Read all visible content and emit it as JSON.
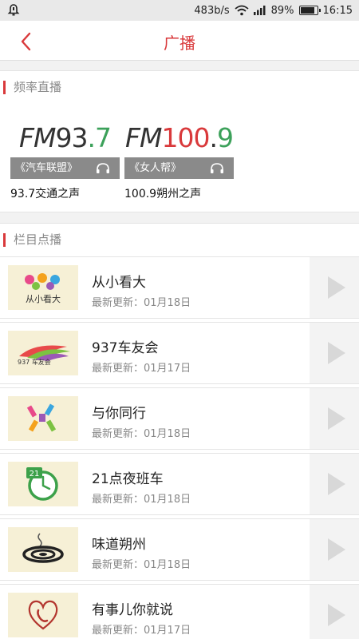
{
  "status_bar": {
    "speed": "483b/s",
    "battery": "89%",
    "time": "16:15"
  },
  "header": {
    "title": "广播"
  },
  "frequency": {
    "section_title": "频率直播",
    "stations": [
      {
        "logo_prefix": "FM",
        "logo_num1": "93",
        "logo_dot": ".",
        "logo_num2": "7",
        "program": "《汽车联盟》",
        "name": "93.7交通之声"
      },
      {
        "logo_prefix": "FM",
        "logo_num1": "100",
        "logo_dot": ".",
        "logo_num2": "9",
        "program": "《女人帮》",
        "name": "100.9朔州之声"
      }
    ]
  },
  "programs": {
    "section_title": "栏目点播",
    "items": [
      {
        "title": "从小看大",
        "updated": "最新更新：01月18日",
        "thumb_label": "从小看大"
      },
      {
        "title": "937车友会",
        "updated": "最新更新：01月17日",
        "thumb_label": "937 车友会"
      },
      {
        "title": "与你同行",
        "updated": "最新更新：01月18日",
        "thumb_label": ""
      },
      {
        "title": "21点夜班车",
        "updated": "最新更新：01月18日",
        "thumb_label": "21"
      },
      {
        "title": "味道朔州",
        "updated": "最新更新：01月18日",
        "thumb_label": ""
      },
      {
        "title": "有事儿你就说",
        "updated": "最新更新：01月17日",
        "thumb_label": ""
      }
    ]
  },
  "colors": {
    "accent": "#d9393b",
    "station_bar": "#8a8a8a"
  }
}
